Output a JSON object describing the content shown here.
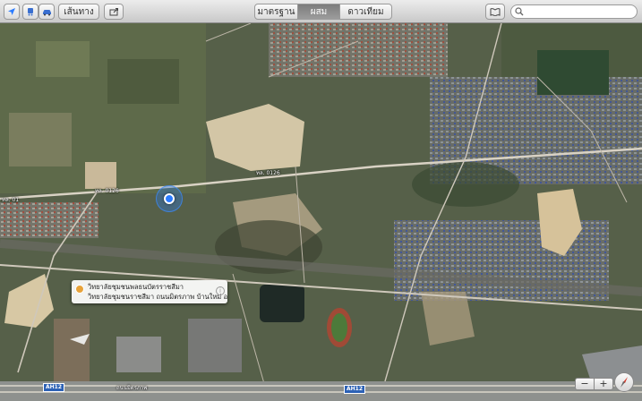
{
  "toolbar": {
    "location_icon": "location-arrow-icon",
    "transit_icon": "transit-icon",
    "car_icon": "car-icon",
    "directions_label": "เส้นทาง",
    "share_icon": "share-icon",
    "view_modes": [
      "มาตรฐาน",
      "ผสม",
      "ดาวเทียม"
    ],
    "active_view": "ผสม",
    "bookmarks_icon": "book-icon",
    "search_placeholder": ""
  },
  "map": {
    "road_labels": [
      "ทล. 01",
      "ทล. 0126",
      "ทล. 0126",
      "ถนนมิตรภาพ"
    ],
    "highway_badges": [
      "AH12",
      "AH12"
    ],
    "bottom_road_label": "ถนนมิตรภาพ",
    "callout": {
      "title": "วิทยาลัยชุมชนพลธนบัตรราชสีมา",
      "subtitle": "วิทยาลัยชุมชนราชสีมา ถนนมิตรภาพ บ้านใหม่ อ.ม..."
    },
    "zoom": {
      "out": "−",
      "in": "+"
    },
    "compass_icon": "compass-icon"
  },
  "colors": {
    "accent": "#2a7bff",
    "highway_badge": "#2c61b5"
  }
}
